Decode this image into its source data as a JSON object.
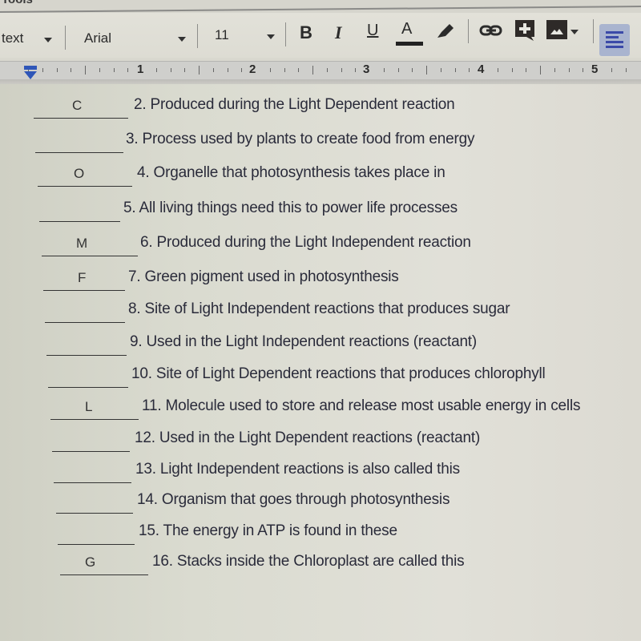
{
  "menubar": {
    "items": [
      "Tools"
    ]
  },
  "toolbar": {
    "style_select": "text",
    "font_select": "Arial",
    "size_select": "11",
    "bold_label": "B",
    "italic_label": "I",
    "underline_label": "U",
    "text_color_label": "A",
    "icons": [
      "highlighter-icon",
      "link-icon",
      "add-comment-icon",
      "insert-image-icon",
      "align-left-icon"
    ]
  },
  "ruler": {
    "numbers": [
      "1",
      "2",
      "3",
      "4",
      "5"
    ]
  },
  "worksheet": {
    "items": [
      {
        "answer": "C",
        "question": "2. Produced during the Light Dependent reaction"
      },
      {
        "answer": "",
        "question": "3. Process used by plants to create food from energy"
      },
      {
        "answer": "O",
        "question": "4. Organelle that photosynthesis takes place in"
      },
      {
        "answer": "",
        "question": "5. All living things need this to power life processes"
      },
      {
        "answer": "M",
        "question": "6. Produced during the Light Independent reaction"
      },
      {
        "answer": "F",
        "question": "7. Green pigment used in photosynthesis"
      },
      {
        "answer": "",
        "question": "8. Site of Light Independent reactions that produces sugar"
      },
      {
        "answer": "",
        "question": "9. Used in the Light Independent reactions (reactant)"
      },
      {
        "answer": "",
        "question": "10. Site of Light Dependent reactions that produces chlorophyll"
      },
      {
        "answer": "L",
        "question": "11. Molecule used to store and release most usable energy in cells"
      },
      {
        "answer": "",
        "question": "12. Used in the Light Dependent reactions (reactant)"
      },
      {
        "answer": "",
        "question": "13. Light Independent reactions is also called this"
      },
      {
        "answer": "",
        "question": "14. Organism that goes through photosynthesis"
      },
      {
        "answer": "",
        "question": "15. The energy in ATP is found in these"
      },
      {
        "answer": "G",
        "question": "16. Stacks inside the Chloroplast are called this"
      }
    ]
  }
}
